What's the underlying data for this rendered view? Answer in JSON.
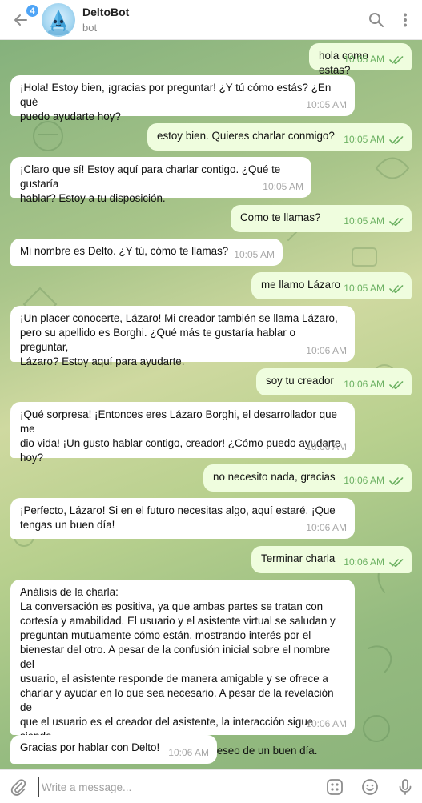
{
  "header": {
    "back_badge": "4",
    "title": "DeltoBot",
    "subtitle": "bot"
  },
  "messages": [
    {
      "dir": "out",
      "text": "hola como estas?",
      "time": "10:05 AM"
    },
    {
      "dir": "in",
      "text": "¡Hola! Estoy bien, ¡gracias por preguntar! ¿Y tú cómo estás? ¿En qué\npuedo ayudarte hoy?",
      "time": "10:05 AM"
    },
    {
      "dir": "out",
      "text": "estoy bien. Quieres charlar conmigo?",
      "time": "10:05 AM"
    },
    {
      "dir": "in",
      "text": "¡Claro que sí! Estoy aquí para charlar contigo. ¿Qué te gustaría\nhablar? Estoy a tu disposición.",
      "time": "10:05 AM"
    },
    {
      "dir": "out",
      "text": "Como te llamas?",
      "time": "10:05 AM"
    },
    {
      "dir": "in",
      "text": "Mi nombre es Delto. ¿Y tú, cómo te llamas?",
      "time": "10:05 AM"
    },
    {
      "dir": "out",
      "text": "me llamo Lázaro",
      "time": "10:05 AM"
    },
    {
      "dir": "in",
      "text": "¡Un placer conocerte, Lázaro! Mi creador también se llama Lázaro,\npero su apellido es Borghi. ¿Qué más te gustaría hablar o preguntar,\nLázaro? Estoy aquí para ayudarte.",
      "time": "10:06 AM"
    },
    {
      "dir": "out",
      "text": "soy tu creador",
      "time": "10:06 AM"
    },
    {
      "dir": "in",
      "text": "¡Qué sorpresa! ¡Entonces eres Lázaro Borghi, el desarrollador que me\ndio vida! ¡Un gusto hablar contigo, creador! ¿Cómo puedo ayudarte\nhoy?",
      "time": "10:06 AM"
    },
    {
      "dir": "out",
      "text": "no necesito nada, gracias",
      "time": "10:06 AM"
    },
    {
      "dir": "in",
      "text": "¡Perfecto, Lázaro! Si en el futuro necesitas algo, aquí estaré. ¡Que\ntengas un buen día!",
      "time": "10:06 AM"
    },
    {
      "dir": "out",
      "text": "Terminar charla",
      "time": "10:06 AM"
    },
    {
      "dir": "in",
      "text": "Análisis de la charla:\nLa conversación es positiva, ya que ambas partes se tratan con\ncortesía y amabilidad. El usuario y el asistente virtual se saludan y\npreguntan mutuamente cómo están, mostrando interés por el\nbienestar del otro. A pesar de la confusión inicial sobre el nombre del\nusuario, el asistente responde de manera amigable y se ofrece a\ncharlar y ayudar en lo que sea necesario. A pesar de la revelación de\nque el usuario es el creador del asistente, la interacción sigue siendo\namigable y cordial, concluyendo con un deseo de un buen día.",
      "time": "10:06 AM"
    },
    {
      "dir": "in",
      "text": "Gracias por hablar con Delto!",
      "time": "10:06 AM"
    }
  ],
  "composer": {
    "placeholder": "Write a message..."
  },
  "colors": {
    "outgoing_bubble": "#effdde",
    "incoming_bubble": "#ffffff",
    "read_ticks": "#6cb162",
    "badge": "#4ea4f6"
  },
  "icons": [
    "back-arrow-icon",
    "search-icon",
    "more-vert-icon",
    "paperclip-icon",
    "bot-commands-icon",
    "emoji-icon",
    "microphone-icon"
  ]
}
